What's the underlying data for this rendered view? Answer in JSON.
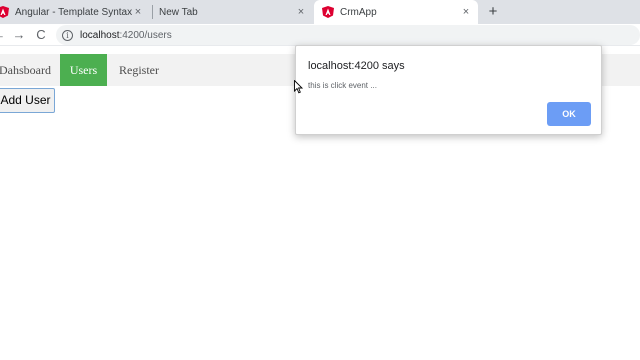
{
  "browser": {
    "tabs": [
      {
        "title": "Angular - Template Syntax",
        "close": "×"
      },
      {
        "title": "New Tab",
        "close": "×"
      },
      {
        "title": "CrmApp",
        "close": "×"
      }
    ],
    "new_tab": "+",
    "nav": {
      "back": "←",
      "forward": "→",
      "reload": "C"
    },
    "url_host": "localhost",
    "url_path": ":4200/users",
    "info_icon": "i"
  },
  "app_nav": {
    "items": [
      {
        "label": "Dahsboard"
      },
      {
        "label": "Users"
      },
      {
        "label": "Register"
      }
    ],
    "active_color": "#4caf50"
  },
  "main": {
    "add_user_label": "Add User"
  },
  "dialog": {
    "title": "localhost:4200 says",
    "message": "this is click event ...",
    "ok_label": "OK"
  }
}
